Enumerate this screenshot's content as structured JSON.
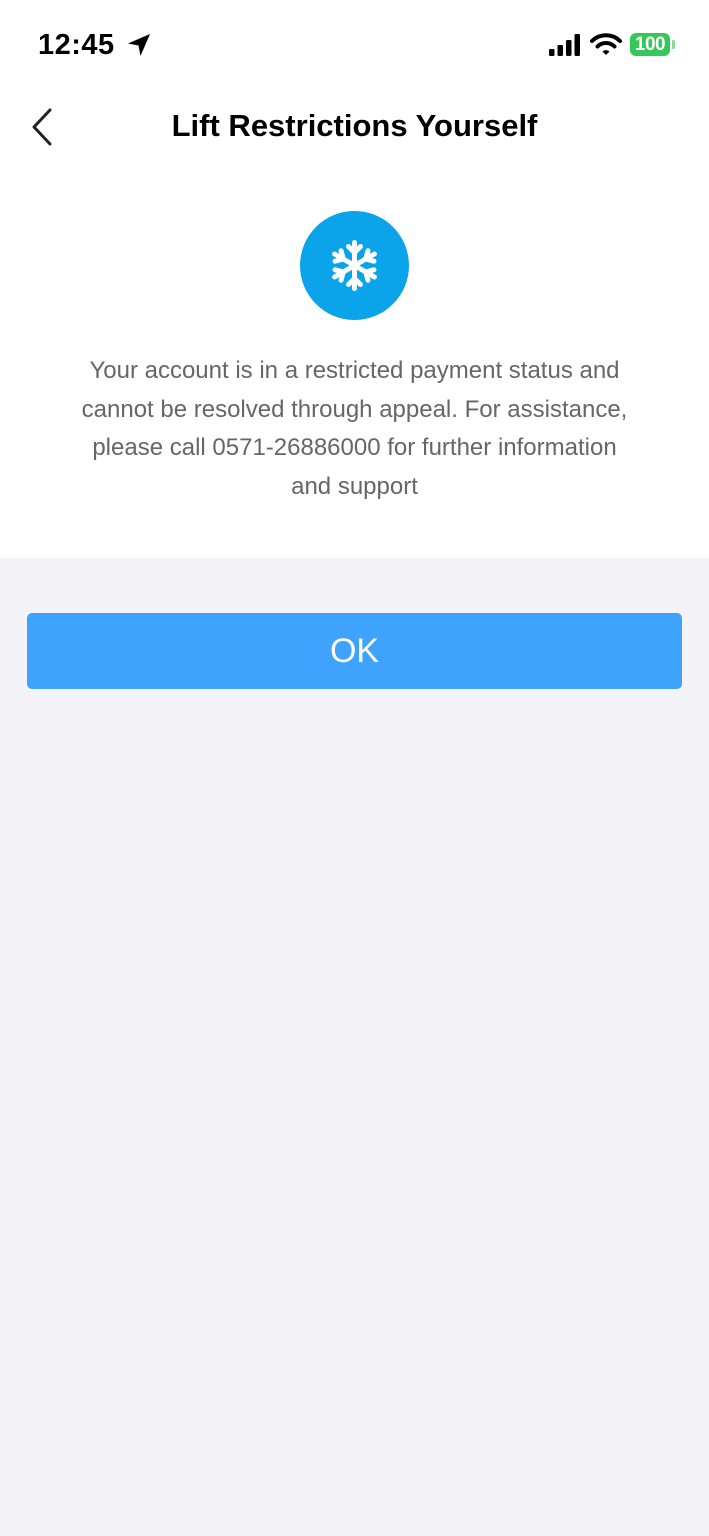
{
  "status_bar": {
    "time": "12:45",
    "battery_level": "100",
    "icons": [
      "location-arrow-icon",
      "cellular-signal-icon",
      "wifi-icon",
      "battery-icon"
    ],
    "battery_color": "#34c759"
  },
  "nav": {
    "title": "Lift Restrictions Yourself",
    "back_icon": "chevron-left-icon"
  },
  "content": {
    "status_icon": "snowflake-icon",
    "icon_color": "#0ba3ea",
    "message": "Your account is in a restricted payment status and cannot be resolved through appeal. For assistance, please call 0571-26886000 for further information and support"
  },
  "actions": {
    "ok_label": "OK",
    "ok_color": "#3fa2fd"
  }
}
